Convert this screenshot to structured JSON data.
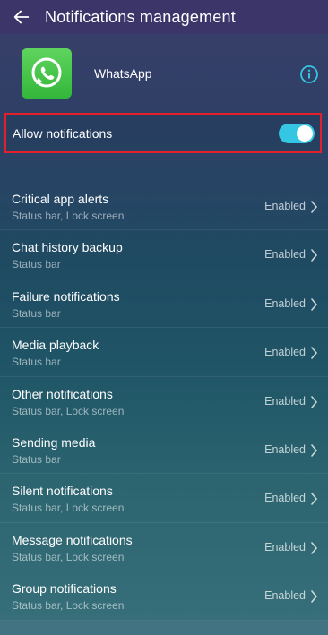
{
  "header": {
    "title": "Notifications management"
  },
  "app": {
    "name": "WhatsApp"
  },
  "allow": {
    "label": "Allow notifications",
    "enabled": true
  },
  "items": [
    {
      "title": "Critical app alerts",
      "subtitle": "Status bar, Lock screen",
      "status": "Enabled"
    },
    {
      "title": "Chat history backup",
      "subtitle": "Status bar",
      "status": "Enabled"
    },
    {
      "title": "Failure notifications",
      "subtitle": "Status bar",
      "status": "Enabled"
    },
    {
      "title": "Media playback",
      "subtitle": "Status bar",
      "status": "Enabled"
    },
    {
      "title": "Other notifications",
      "subtitle": "Status bar, Lock screen",
      "status": "Enabled"
    },
    {
      "title": "Sending media",
      "subtitle": "Status bar",
      "status": "Enabled"
    },
    {
      "title": "Silent notifications",
      "subtitle": "Status bar, Lock screen",
      "status": "Enabled"
    },
    {
      "title": "Message notifications",
      "subtitle": "Status bar, Lock screen",
      "status": "Enabled"
    },
    {
      "title": "Group notifications",
      "subtitle": "Status bar, Lock screen",
      "status": "Enabled"
    }
  ],
  "colors": {
    "header_bg": "#3b356a",
    "toggle_on": "#34c6e2",
    "highlight_border": "#e21f2b",
    "app_icon_green": "#33b73a",
    "info_icon": "#34c6e2"
  },
  "icons": {
    "back": "arrow-back-icon",
    "app": "whatsapp-icon",
    "info": "info-icon",
    "chevron": "chevron-right-icon"
  }
}
